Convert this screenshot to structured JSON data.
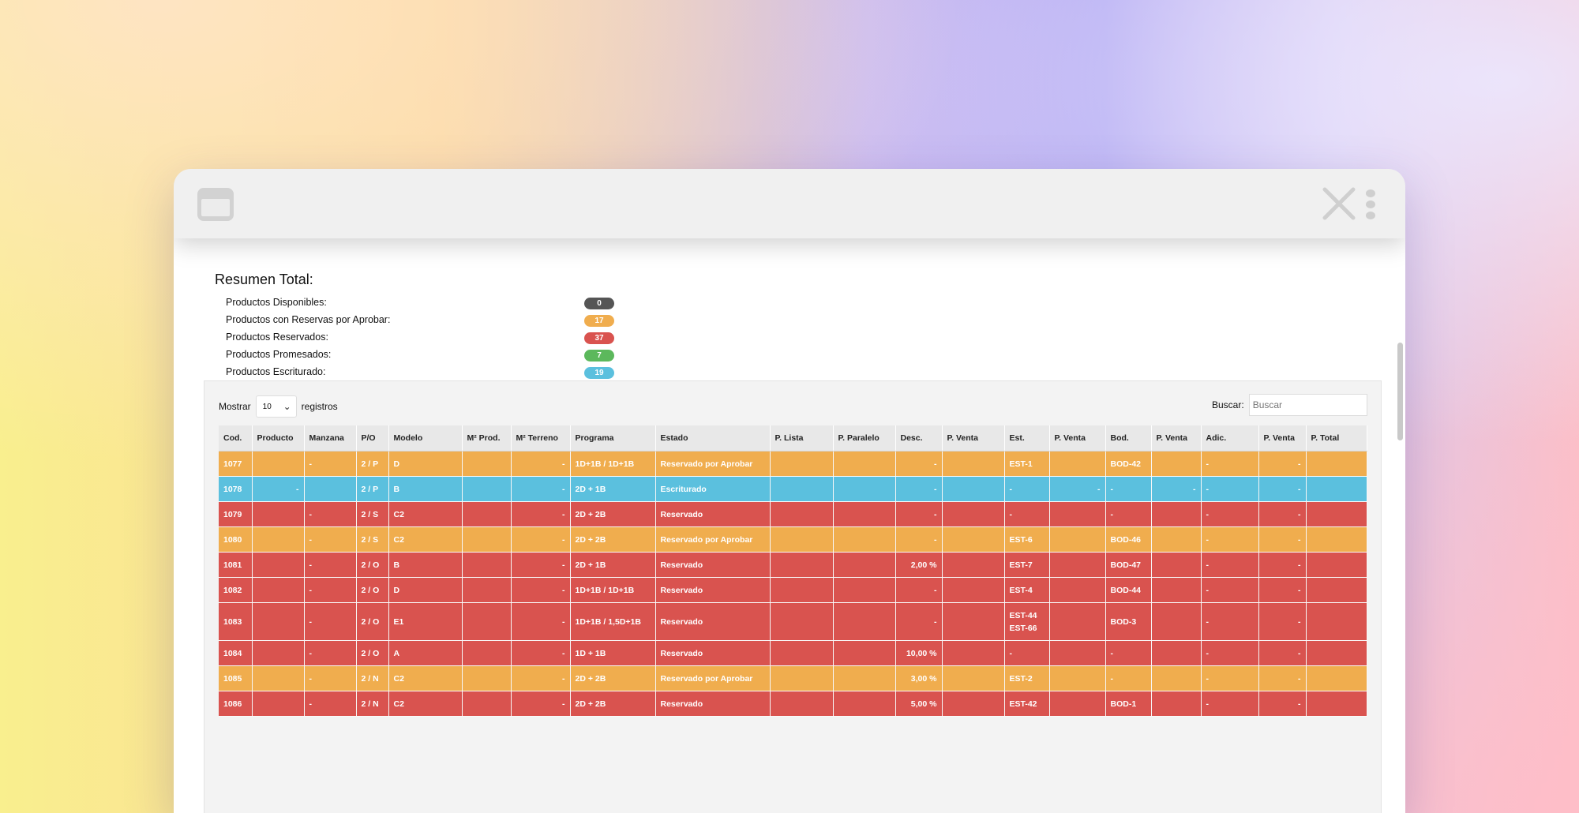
{
  "summary": {
    "title": "Resumen Total:",
    "items": [
      {
        "label": "Productos Disponibles:",
        "count": "0",
        "color": "#555555"
      },
      {
        "label": "Productos con Reservas por Aprobar:",
        "count": "17",
        "color": "#f0ad4e"
      },
      {
        "label": "Productos Reservados:",
        "count": "37",
        "color": "#d9534f"
      },
      {
        "label": "Productos Promesados:",
        "count": "7",
        "color": "#5cb85c"
      },
      {
        "label": "Productos Escriturado:",
        "count": "19",
        "color": "#5bc0de"
      }
    ]
  },
  "controls": {
    "show_label": "Mostrar",
    "page_size": "10",
    "records_label": "registros",
    "search_label": "Buscar:",
    "search_placeholder": "Buscar"
  },
  "table": {
    "columns": [
      "Cod.",
      "Producto",
      "Manzana",
      "P/O",
      "Modelo",
      "M² Prod.",
      "M² Terreno",
      "Programa",
      "Estado",
      "P. Lista",
      "P. Paralelo",
      "Desc.",
      "P. Venta",
      "Est.",
      "P. Venta",
      "Bod.",
      "P. Venta",
      "Adic.",
      "P. Venta",
      "P. Total"
    ],
    "rows": [
      {
        "status": "orange",
        "cells": [
          "1077",
          "",
          "-",
          "2 / P",
          "D",
          "",
          "-",
          "1D+1B / 1D+1B",
          "Reservado por Aprobar",
          "",
          "",
          "-",
          "",
          "EST-1",
          "",
          "BOD-42",
          "",
          "-",
          "-",
          ""
        ]
      },
      {
        "status": "blue",
        "cells": [
          "1078",
          "-",
          "",
          "2 / P",
          "B",
          "",
          "-",
          "2D + 1B",
          "Escriturado",
          "",
          "",
          "-",
          "",
          "-",
          "-",
          "-",
          "-",
          "-",
          "-",
          ""
        ]
      },
      {
        "status": "red",
        "cells": [
          "1079",
          "",
          "-",
          "2 / S",
          "C2",
          "",
          "-",
          "2D + 2B",
          "Reservado",
          "",
          "",
          "-",
          "",
          "-",
          "",
          "-",
          "",
          "-",
          "-",
          ""
        ]
      },
      {
        "status": "orange",
        "cells": [
          "1080",
          "",
          "-",
          "2 / S",
          "C2",
          "",
          "-",
          "2D + 2B",
          "Reservado por Aprobar",
          "",
          "",
          "-",
          "",
          "EST-6",
          "",
          "BOD-46",
          "",
          "-",
          "-",
          ""
        ]
      },
      {
        "status": "red",
        "cells": [
          "1081",
          "",
          "-",
          "2 / O",
          "B",
          "",
          "-",
          "2D + 1B",
          "Reservado",
          "",
          "",
          "2,00 %",
          "",
          "EST-7",
          "",
          "BOD-47",
          "",
          "-",
          "-",
          ""
        ]
      },
      {
        "status": "red",
        "cells": [
          "1082",
          "",
          "-",
          "2 / O",
          "D",
          "",
          "-",
          "1D+1B / 1D+1B",
          "Reservado",
          "",
          "",
          "-",
          "",
          "EST-4",
          "",
          "BOD-44",
          "",
          "-",
          "-",
          ""
        ]
      },
      {
        "status": "red",
        "tall": true,
        "cells": [
          "1083",
          "",
          "-",
          "2 / O",
          "E1",
          "",
          "-",
          "1D+1B / 1,5D+1B",
          "Reservado",
          "",
          "",
          "-",
          "",
          "EST-44\nEST-66",
          "",
          "BOD-3",
          "",
          "-",
          "-",
          ""
        ]
      },
      {
        "status": "red",
        "cells": [
          "1084",
          "",
          "-",
          "2 / O",
          "A",
          "",
          "-",
          "1D + 1B",
          "Reservado",
          "",
          "",
          "10,00 %",
          "",
          "-",
          "",
          "-",
          "",
          "-",
          "-",
          ""
        ]
      },
      {
        "status": "orange",
        "cells": [
          "1085",
          "",
          "-",
          "2 / N",
          "C2",
          "",
          "-",
          "2D + 2B",
          "Reservado por Aprobar",
          "",
          "",
          "3,00 %",
          "",
          "EST-2",
          "",
          "-",
          "",
          "-",
          "-",
          ""
        ]
      },
      {
        "status": "red",
        "cells": [
          "1086",
          "",
          "-",
          "2 / N",
          "C2",
          "",
          "-",
          "2D + 2B",
          "Reservado",
          "",
          "",
          "5,00 %",
          "",
          "EST-42",
          "",
          "BOD-1",
          "",
          "-",
          "-",
          ""
        ]
      }
    ]
  }
}
